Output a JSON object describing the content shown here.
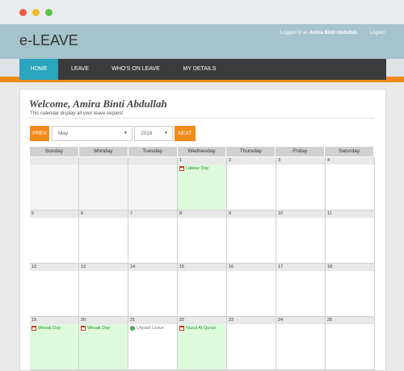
{
  "window": {
    "colors": {
      "close": "#f05a4d",
      "minimize": "#f4bc2a",
      "maximize": "#5fc242"
    }
  },
  "header": {
    "logo": "e-LEAVE",
    "logged_in_prefix": "Logged in as",
    "user_name": "Amira Binti Abdullah",
    "logout": "Logout"
  },
  "nav": {
    "items": [
      {
        "label": "HOME",
        "active": true
      },
      {
        "label": "LEAVE",
        "active": false
      },
      {
        "label": "WHO'S ON LEAVE",
        "active": false
      },
      {
        "label": "MY DETAILS",
        "active": false
      }
    ]
  },
  "page": {
    "welcome": "Welcome, Amira Binti Abdullah",
    "subtitle": "This calendar display all your leave request"
  },
  "controls": {
    "prev": "PREV",
    "month": "May",
    "year": "2019",
    "next": "NEXT"
  },
  "calendar": {
    "weekdays": [
      "Sunday",
      "Monday",
      "Tuesday",
      "Wednesday",
      "Thursday",
      "Friday",
      "Saturday"
    ],
    "weeks": [
      [
        {
          "day": ""
        },
        {
          "day": ""
        },
        {
          "day": ""
        },
        {
          "day": "1",
          "event": "Labour Day",
          "type": "holiday"
        },
        {
          "day": "2"
        },
        {
          "day": "3"
        },
        {
          "day": "4"
        }
      ],
      [
        {
          "day": "5"
        },
        {
          "day": "6"
        },
        {
          "day": "7"
        },
        {
          "day": "8"
        },
        {
          "day": "9"
        },
        {
          "day": "10"
        },
        {
          "day": "11"
        }
      ],
      [
        {
          "day": "12"
        },
        {
          "day": "13"
        },
        {
          "day": "14"
        },
        {
          "day": "15"
        },
        {
          "day": "16"
        },
        {
          "day": "17"
        },
        {
          "day": "18"
        }
      ],
      [
        {
          "day": "19",
          "event": "Wesak Day",
          "type": "holiday"
        },
        {
          "day": "20",
          "event": "Wesak Day",
          "type": "holiday"
        },
        {
          "day": "21",
          "event": "Unpaid Leave",
          "type": "leave"
        },
        {
          "day": "22",
          "event": "Nuzul Al-Quran",
          "type": "holiday"
        },
        {
          "day": "23"
        },
        {
          "day": "24"
        },
        {
          "day": "25"
        }
      ]
    ],
    "colors": {
      "holiday": "#ddfadd",
      "leave_dot": "#4cae4c",
      "accent": "#f08a1a",
      "nav_active": "#29a5bd"
    }
  }
}
